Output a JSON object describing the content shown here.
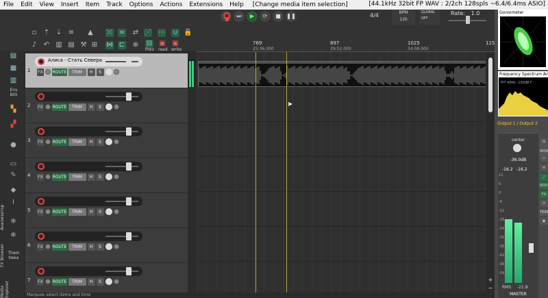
{
  "menu": {
    "items": [
      "File",
      "Edit",
      "View",
      "Insert",
      "Item",
      "Track",
      "Options",
      "Actions",
      "Extensions",
      "Help"
    ],
    "last_action": "[Change media item selection]",
    "status": "[44.1kHz 32bit FP WAV : 2/2ch 128spls ~6.4/6.4ms ASIO]"
  },
  "toolbar": {
    "prev_label": "Prev",
    "read_label": "read",
    "write_label": "write"
  },
  "transport": {
    "time_signature": "4/4",
    "bpm_label": "BPM",
    "bpm_value": "120",
    "global_label": "GLOBAL",
    "global_state": "OFF",
    "rate_label": "Rate:",
    "rate_value": "1.0"
  },
  "leftbar": {
    "env_label": "Env\nBIG",
    "vtab_1": "Анализатор",
    "vtab_2": "FX Browser",
    "vtab_3": "Media Explorer",
    "theme_label": "Them\ntwea"
  },
  "tracks": [
    {
      "num": "1",
      "name": "Алиса - Стать Севера",
      "selected": true
    },
    {
      "num": "2",
      "name": "",
      "selected": false
    },
    {
      "num": "3",
      "name": "",
      "selected": false
    },
    {
      "num": "4",
      "name": "",
      "selected": false
    },
    {
      "num": "5",
      "name": "",
      "selected": false
    },
    {
      "num": "6",
      "name": "",
      "selected": false
    },
    {
      "num": "7",
      "name": "",
      "selected": false
    }
  ],
  "track_controls": {
    "fx": "FX",
    "route": "ROUTE",
    "trim": "TRIM",
    "mute": "M",
    "solo": "S"
  },
  "ruler": {
    "marks": [
      {
        "bar": "769",
        "time": "25:36.000"
      },
      {
        "bar": "897",
        "time": "29:52.000"
      },
      {
        "bar": "1025",
        "time": "34:08.000"
      },
      {
        "bar": "115",
        "time": ""
      }
    ]
  },
  "statusbar": "Marquee select items and time",
  "analyzer": {
    "goniometer_title": "Goniometer",
    "fsa_title": "Frequency Spectrum Analyzer",
    "fsa_readout": "PIT 40Hz -100dB F",
    "output_label": "Output 1 / Output 2"
  },
  "master": {
    "pan_label": "center",
    "volume_db": "-36.0dB",
    "peak_left": "-16.2",
    "peak_right": "-16.2",
    "rms_label": "RMS",
    "rms_value": "-21.8",
    "label": "MASTER",
    "scale": [
      "12",
      "6",
      "0",
      "-6",
      "-12",
      "-18",
      "-24",
      "-30",
      "-36",
      "-42",
      "-48",
      "-54"
    ],
    "level_left": 0.58,
    "level_right": 0.55,
    "side_buttons": {
      "fx": "FX",
      "route": "ROUTE",
      "trim": "TRIM",
      "mono": "MONO"
    }
  },
  "colors": {
    "route_green": "#2f6b45",
    "record_red": "#e04a4a",
    "cursor_yellow": "#b9a33a",
    "meter_green": "#3fcf83"
  }
}
